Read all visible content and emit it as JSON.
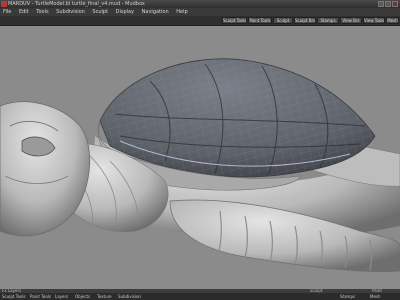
{
  "window": {
    "title": "MARDUV - TurtleModel.bl turtle_final_v4.mud - Mudbox",
    "app_icon": "mudbox-app-icon"
  },
  "menu": [
    "File",
    "Edit",
    "Tools",
    "Subdivision",
    "Sculpt",
    "Display",
    "Navigation",
    "Help"
  ],
  "shelf_tabs": [
    "Sculpt Tools",
    "Paint Tools",
    "Sculpt",
    "Sculpt Brs",
    "Stamps",
    "View Brs",
    "View Tools",
    "Mesh"
  ],
  "viewport": {
    "background": "#8b8b8b",
    "mesh_color": "#c4c4c4",
    "shell_color": "#5f6368",
    "wireframe_color": "#9aa3c9",
    "subject": "sea turtle sculpt"
  },
  "panel_strip": [
    "Fx Layers",
    "Sculpt",
    "Paint"
  ],
  "status_items": [
    "Sculpt Tools",
    "Paint Tools",
    "Layers",
    "Objects",
    "Texture",
    "Subdivision",
    "Stamps",
    "Mesh"
  ]
}
